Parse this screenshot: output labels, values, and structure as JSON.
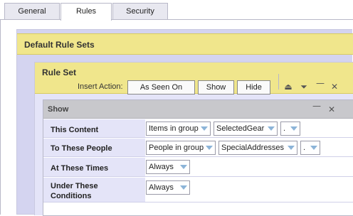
{
  "tabs": [
    {
      "label": "General"
    },
    {
      "label": "Rules"
    },
    {
      "label": "Security"
    }
  ],
  "default_rule_sets": {
    "title": "Default Rule Sets"
  },
  "rule_set": {
    "title": "Rule Set",
    "insert_action_label": "Insert Action:",
    "buttons": {
      "as_seen_on": "As Seen On",
      "show": "Show",
      "hide": "Hide"
    }
  },
  "show_panel": {
    "title": "Show",
    "rows": [
      {
        "label": "This Content",
        "selects": [
          "Items in group",
          "SelectedGear",
          "."
        ]
      },
      {
        "label": "To These People",
        "selects": [
          "People in group",
          "SpecialAddresses",
          "."
        ]
      },
      {
        "label": "At These Times",
        "selects": [
          "Always"
        ]
      },
      {
        "label_line1": "Under These",
        "label_line2": "Conditions",
        "selects": [
          "Always"
        ]
      }
    ]
  },
  "colors": {
    "accent_yellow": "#f0e68c",
    "frame_lavender": "#d4d4f0",
    "label_lavender": "#e4e4f8",
    "dropdown_arrow": "#8cb4d8"
  },
  "icons": [
    "move-up-icon",
    "move-down-icon",
    "minimize-icon",
    "close-icon"
  ]
}
